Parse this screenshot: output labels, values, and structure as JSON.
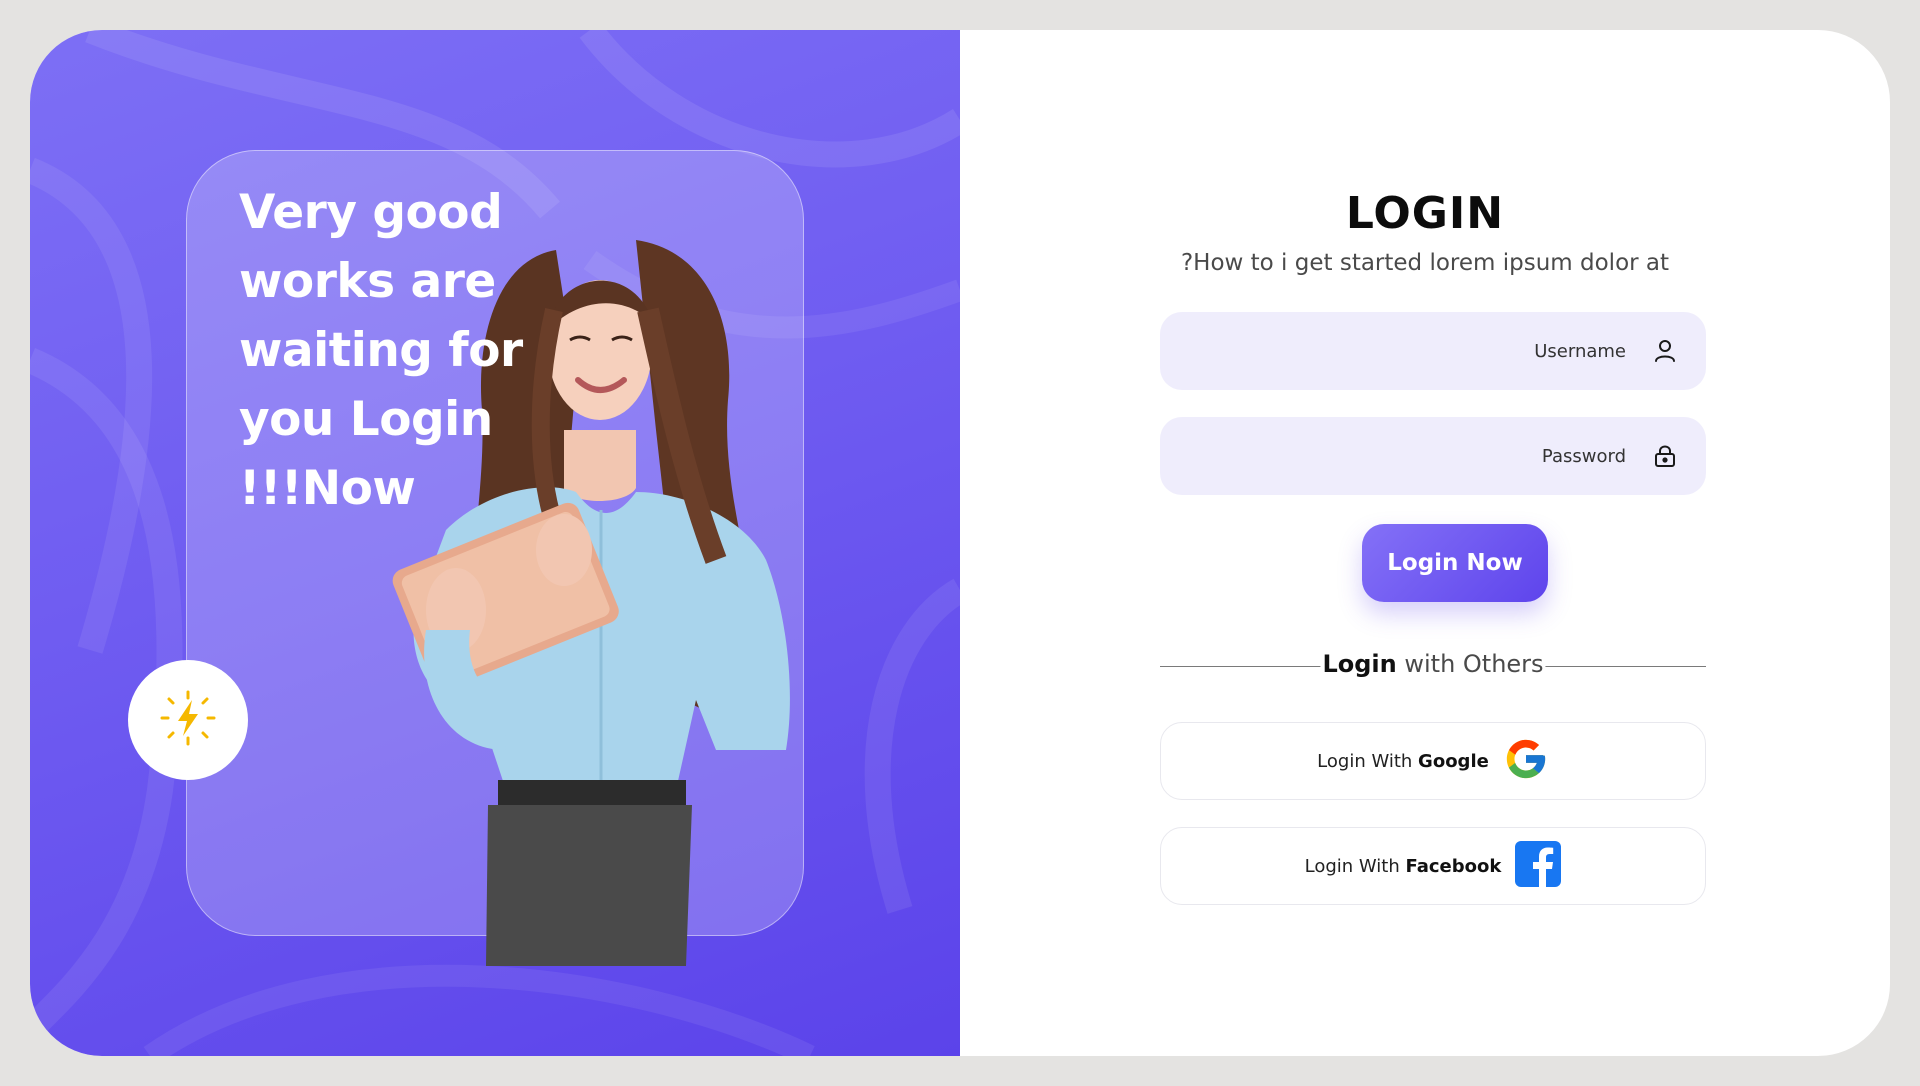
{
  "hero": {
    "headline": "Very good\nworks are\nwaiting for\nyou Login\n!!!Now",
    "badge_icon": "lightning-bolt-icon"
  },
  "login": {
    "title": "LOGIN",
    "subtitle": "?How to i get started lorem ipsum dolor at",
    "username_placeholder": "Username",
    "password_placeholder": "Password",
    "submit_label": "Login Now",
    "divider_bold": "Login",
    "divider_rest": " with Others",
    "google_prefix": "Login With ",
    "google_bold": "Google",
    "facebook_prefix": "Login With ",
    "facebook_bold": "Facebook"
  },
  "colors": {
    "accent": "#6f5cf1",
    "field_bg": "#efedfc",
    "facebook_blue": "#1877f2",
    "bolt_yellow": "#f5b800"
  }
}
